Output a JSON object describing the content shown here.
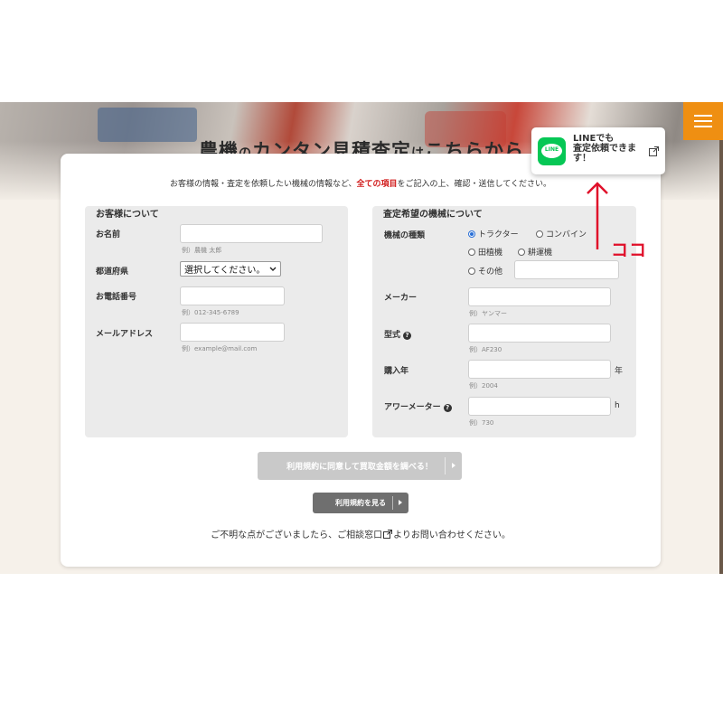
{
  "hero": {
    "title_part1": "農機",
    "title_part2": "の",
    "title_part3": "カンタン見積査定",
    "title_part4": "は",
    "title_part5": "こちらから"
  },
  "intro": {
    "text_before": "お客様の情報・査定を依頼したい機械の情報など、",
    "highlight": "全ての項目",
    "text_after": "をご記入の上、確認・送信してください。"
  },
  "customer": {
    "title": "お客様について",
    "name_label": "お名前",
    "name_hint": "例）農機 太郎",
    "pref_label": "都道府県",
    "pref_value": "選択してください。",
    "phone_label": "お電話番号",
    "phone_hint": "例）012-345-6789",
    "email_label": "メールアドレス",
    "email_hint": "例）example@mail.com"
  },
  "machine": {
    "title": "査定希望の機械について",
    "type_label": "機械の種類",
    "types": [
      "トラクター",
      "コンバイン",
      "田植機",
      "耕運機",
      "その他"
    ],
    "selected_type": "トラクター",
    "maker_label": "メーカー",
    "maker_hint": "例）ヤンマー",
    "model_label": "型式",
    "model_hint": "例）AF230",
    "year_label": "購入年",
    "year_unit": "年",
    "year_hint": "例）2004",
    "hour_label": "アワーメーター",
    "hour_unit": "h",
    "hour_hint": "例）730"
  },
  "buttons": {
    "agree_label": "利用規約に同意して買取金額を調べる！",
    "terms_label": "利用規約を見る"
  },
  "contact": {
    "text_before": "ご不明な点がございましたら、ご相談窓口",
    "text_after": "よりお問い合わせください。"
  },
  "line_popup": {
    "logo_text": "LINE",
    "line1": "LINEでも",
    "line2": "査定依頼できま",
    "line3": "す！"
  },
  "annotation": {
    "label": "ココ",
    "color": "#e0102a"
  },
  "colors": {
    "menu_button": "#ef8f12",
    "line_green": "#06c755",
    "highlight_red": "#d01818"
  },
  "icons": [
    "menu-icon",
    "help-icon",
    "external-link-icon",
    "line-logo-icon",
    "up-arrow-icon"
  ]
}
